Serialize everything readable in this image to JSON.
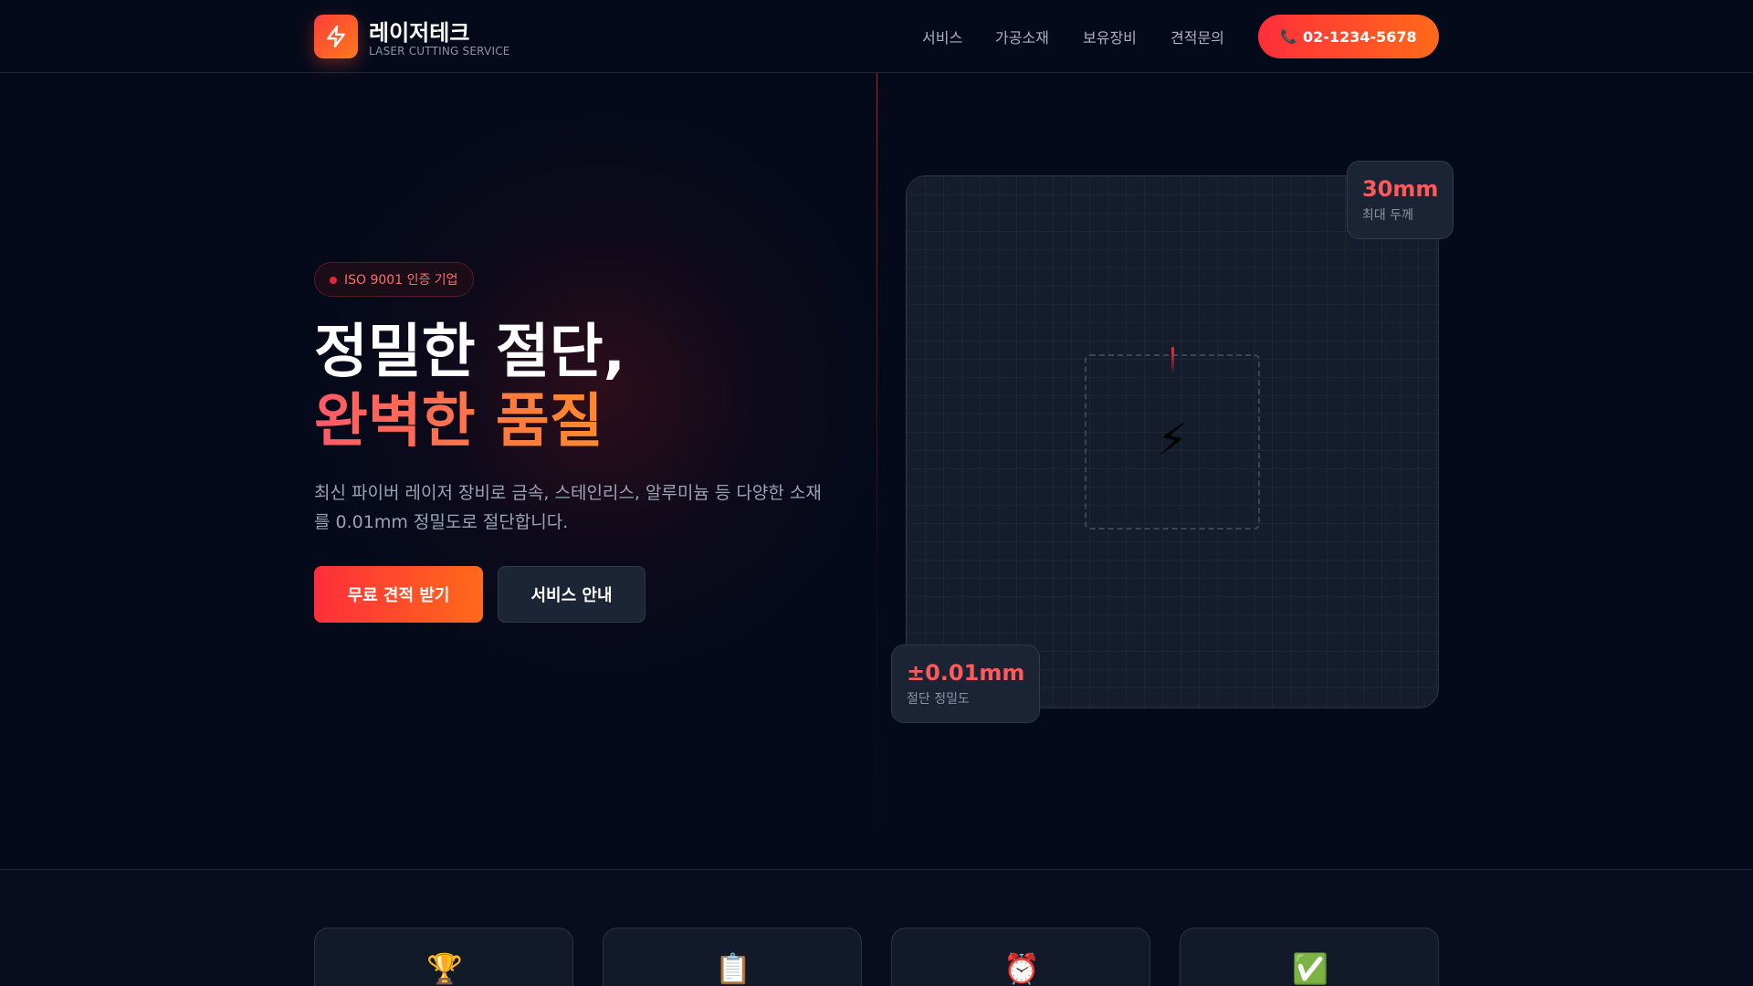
{
  "header": {
    "logo_name": "레이저테크",
    "logo_sub": "LASER CUTTING SERVICE",
    "nav": [
      "서비스",
      "가공소재",
      "보유장비",
      "견적문의"
    ],
    "phone": "02-1234-5678",
    "phone_icon": "phone-icon"
  },
  "hero": {
    "badge": "ISO 9001 인증 기업",
    "title_line1": "정밀한 절단,",
    "title_line2": "완벽한 품질",
    "description": "최신 파이버 레이저 장비로 금속, 스테인리스, 알루미늄 등 다양한 소재를 0.01mm 정밀도로 절단합니다.",
    "primary_button": "무료 견적 받기",
    "secondary_button": "서비스 안내"
  },
  "visual": {
    "center_icon": "lightning-bolt-icon",
    "stat_top": {
      "value": "30mm",
      "label": "최대 두께"
    },
    "stat_bottom": {
      "value": "±0.01mm",
      "label": "절단 정밀도"
    }
  },
  "features": {
    "icons": [
      "trophy-icon",
      "clipboard-icon",
      "alarm-clock-icon",
      "check-mark-icon"
    ],
    "glyphs": [
      "🏆",
      "📋",
      "⏰",
      "✅"
    ]
  },
  "colors": {
    "background": "#050a1a",
    "accent_start": "#ff2e3b",
    "accent_end": "#ff6a1a",
    "stat_value": "#ff5a5a"
  }
}
